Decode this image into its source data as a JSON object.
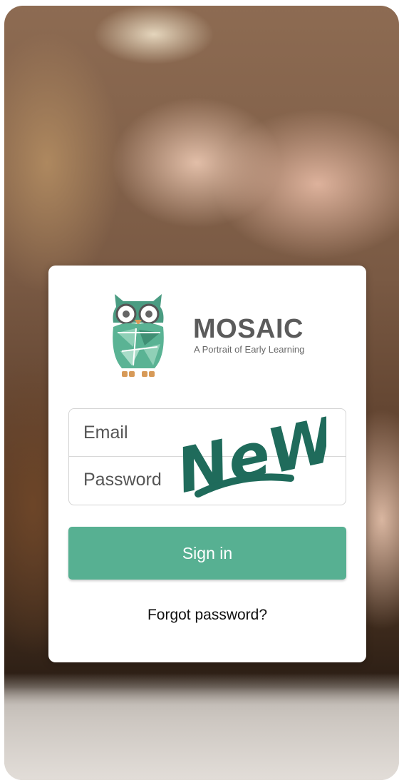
{
  "brand": {
    "name": "MOSAIC",
    "tagline": "A Portrait of Early Learning",
    "logo_icon": "owl-logo-icon"
  },
  "login": {
    "email_placeholder": "Email",
    "password_placeholder": "Password",
    "signin_label": "Sign in",
    "forgot_label": "Forgot password?"
  },
  "badge": {
    "text": "NeW!"
  },
  "colors": {
    "accent": "#57b092",
    "badge": "#1f6b5b",
    "brand_text": "#5b5b5b"
  }
}
